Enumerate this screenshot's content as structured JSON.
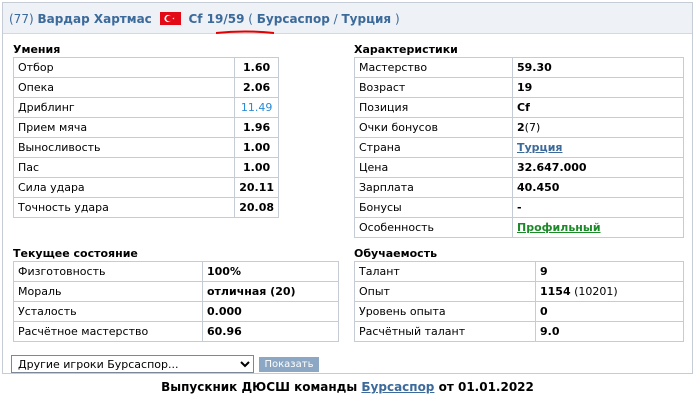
{
  "header": {
    "rank": "(77)",
    "name": "Вардар Хартмас",
    "position_number": "Cf 19/59",
    "open_paren": "(",
    "club": "Бурсаспор",
    "sep": "/",
    "country": "Турция",
    "close_paren": ")"
  },
  "skills": {
    "title": "Умения",
    "rows": [
      {
        "label": "Отбор",
        "value": "1.60"
      },
      {
        "label": "Опека",
        "value": "2.06"
      },
      {
        "label": "Дриблинг",
        "value": "11.49"
      },
      {
        "label": "Прием мяча",
        "value": "1.96"
      },
      {
        "label": "Выносливость",
        "value": "1.00"
      },
      {
        "label": "Пас",
        "value": "1.00"
      },
      {
        "label": "Сила удара",
        "value": "20.11"
      },
      {
        "label": "Точность удара",
        "value": "20.08"
      }
    ]
  },
  "characteristics": {
    "title": "Характеристики",
    "rows": [
      {
        "label": "Мастерство",
        "value": "59.30"
      },
      {
        "label": "Возраст",
        "value": "19"
      },
      {
        "label": "Позиция",
        "value": "Cf"
      },
      {
        "label": "Очки бонусов",
        "value": "2",
        "extra": "(7)"
      },
      {
        "label": "Страна",
        "value": "Турция"
      },
      {
        "label": "Цена",
        "value": "32.647.000"
      },
      {
        "label": "Зарплата",
        "value": "40.450"
      },
      {
        "label": "Бонусы",
        "value": "-"
      },
      {
        "label": "Особенность",
        "value": "Профильный"
      }
    ]
  },
  "state": {
    "title": "Текущее состояние",
    "rows": [
      {
        "label": "Физготовность",
        "value": "100%"
      },
      {
        "label": "Мораль",
        "value": "отличная (20)"
      },
      {
        "label": "Усталость",
        "value": "0.000"
      },
      {
        "label": "Расчётное мастерство",
        "value": "60.96"
      }
    ]
  },
  "learning": {
    "title": "Обучаемость",
    "rows": [
      {
        "label": "Талант",
        "value": "9"
      },
      {
        "label": "Опыт",
        "value": "1154",
        "extra": "(10201)"
      },
      {
        "label": "Уровень опыта",
        "value": "0"
      },
      {
        "label": "Расчётный талант",
        "value": "9.0"
      }
    ]
  },
  "controls": {
    "select_value": "Другие игроки Бурсаспор...",
    "show_button": "Показать"
  },
  "footer": {
    "prefix": "Выпускник ДЮСШ команды",
    "club": "Бурсаспор",
    "suffix": "от 01.01.2022"
  },
  "colors": {
    "accent": "#3b6a9b",
    "highlight": "#2a8ad4",
    "feature_green": "#1d8a2a",
    "underline_red": "#e30000"
  },
  "icons": {
    "flag": "turkey-flag-icon"
  }
}
